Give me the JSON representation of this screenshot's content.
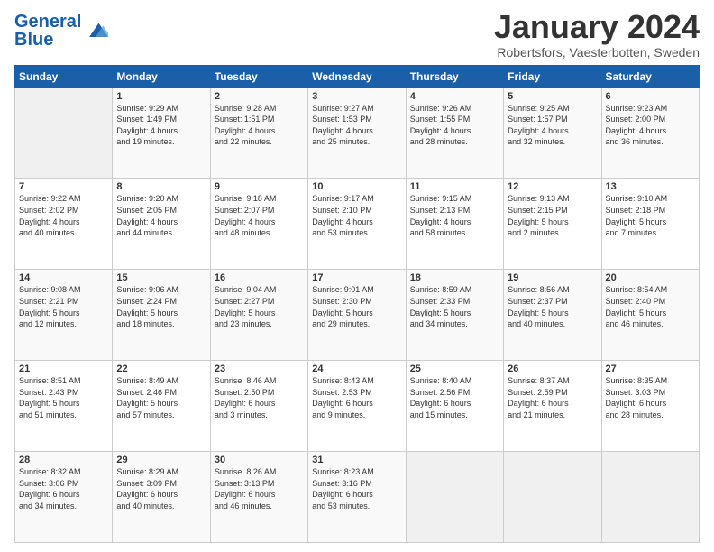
{
  "logo": {
    "general": "General",
    "blue": "Blue"
  },
  "header": {
    "title": "January 2024",
    "subtitle": "Robertsfors, Vaesterbotten, Sweden"
  },
  "days_of_week": [
    "Sunday",
    "Monday",
    "Tuesday",
    "Wednesday",
    "Thursday",
    "Friday",
    "Saturday"
  ],
  "weeks": [
    [
      {
        "day": "",
        "text": ""
      },
      {
        "day": "1",
        "text": "Sunrise: 9:29 AM\nSunset: 1:49 PM\nDaylight: 4 hours\nand 19 minutes."
      },
      {
        "day": "2",
        "text": "Sunrise: 9:28 AM\nSunset: 1:51 PM\nDaylight: 4 hours\nand 22 minutes."
      },
      {
        "day": "3",
        "text": "Sunrise: 9:27 AM\nSunset: 1:53 PM\nDaylight: 4 hours\nand 25 minutes."
      },
      {
        "day": "4",
        "text": "Sunrise: 9:26 AM\nSunset: 1:55 PM\nDaylight: 4 hours\nand 28 minutes."
      },
      {
        "day": "5",
        "text": "Sunrise: 9:25 AM\nSunset: 1:57 PM\nDaylight: 4 hours\nand 32 minutes."
      },
      {
        "day": "6",
        "text": "Sunrise: 9:23 AM\nSunset: 2:00 PM\nDaylight: 4 hours\nand 36 minutes."
      }
    ],
    [
      {
        "day": "7",
        "text": "Sunrise: 9:22 AM\nSunset: 2:02 PM\nDaylight: 4 hours\nand 40 minutes."
      },
      {
        "day": "8",
        "text": "Sunrise: 9:20 AM\nSunset: 2:05 PM\nDaylight: 4 hours\nand 44 minutes."
      },
      {
        "day": "9",
        "text": "Sunrise: 9:18 AM\nSunset: 2:07 PM\nDaylight: 4 hours\nand 48 minutes."
      },
      {
        "day": "10",
        "text": "Sunrise: 9:17 AM\nSunset: 2:10 PM\nDaylight: 4 hours\nand 53 minutes."
      },
      {
        "day": "11",
        "text": "Sunrise: 9:15 AM\nSunset: 2:13 PM\nDaylight: 4 hours\nand 58 minutes."
      },
      {
        "day": "12",
        "text": "Sunrise: 9:13 AM\nSunset: 2:15 PM\nDaylight: 5 hours\nand 2 minutes."
      },
      {
        "day": "13",
        "text": "Sunrise: 9:10 AM\nSunset: 2:18 PM\nDaylight: 5 hours\nand 7 minutes."
      }
    ],
    [
      {
        "day": "14",
        "text": "Sunrise: 9:08 AM\nSunset: 2:21 PM\nDaylight: 5 hours\nand 12 minutes."
      },
      {
        "day": "15",
        "text": "Sunrise: 9:06 AM\nSunset: 2:24 PM\nDaylight: 5 hours\nand 18 minutes."
      },
      {
        "day": "16",
        "text": "Sunrise: 9:04 AM\nSunset: 2:27 PM\nDaylight: 5 hours\nand 23 minutes."
      },
      {
        "day": "17",
        "text": "Sunrise: 9:01 AM\nSunset: 2:30 PM\nDaylight: 5 hours\nand 29 minutes."
      },
      {
        "day": "18",
        "text": "Sunrise: 8:59 AM\nSunset: 2:33 PM\nDaylight: 5 hours\nand 34 minutes."
      },
      {
        "day": "19",
        "text": "Sunrise: 8:56 AM\nSunset: 2:37 PM\nDaylight: 5 hours\nand 40 minutes."
      },
      {
        "day": "20",
        "text": "Sunrise: 8:54 AM\nSunset: 2:40 PM\nDaylight: 5 hours\nand 46 minutes."
      }
    ],
    [
      {
        "day": "21",
        "text": "Sunrise: 8:51 AM\nSunset: 2:43 PM\nDaylight: 5 hours\nand 51 minutes."
      },
      {
        "day": "22",
        "text": "Sunrise: 8:49 AM\nSunset: 2:46 PM\nDaylight: 5 hours\nand 57 minutes."
      },
      {
        "day": "23",
        "text": "Sunrise: 8:46 AM\nSunset: 2:50 PM\nDaylight: 6 hours\nand 3 minutes."
      },
      {
        "day": "24",
        "text": "Sunrise: 8:43 AM\nSunset: 2:53 PM\nDaylight: 6 hours\nand 9 minutes."
      },
      {
        "day": "25",
        "text": "Sunrise: 8:40 AM\nSunset: 2:56 PM\nDaylight: 6 hours\nand 15 minutes."
      },
      {
        "day": "26",
        "text": "Sunrise: 8:37 AM\nSunset: 2:59 PM\nDaylight: 6 hours\nand 21 minutes."
      },
      {
        "day": "27",
        "text": "Sunrise: 8:35 AM\nSunset: 3:03 PM\nDaylight: 6 hours\nand 28 minutes."
      }
    ],
    [
      {
        "day": "28",
        "text": "Sunrise: 8:32 AM\nSunset: 3:06 PM\nDaylight: 6 hours\nand 34 minutes."
      },
      {
        "day": "29",
        "text": "Sunrise: 8:29 AM\nSunset: 3:09 PM\nDaylight: 6 hours\nand 40 minutes."
      },
      {
        "day": "30",
        "text": "Sunrise: 8:26 AM\nSunset: 3:13 PM\nDaylight: 6 hours\nand 46 minutes."
      },
      {
        "day": "31",
        "text": "Sunrise: 8:23 AM\nSunset: 3:16 PM\nDaylight: 6 hours\nand 53 minutes."
      },
      {
        "day": "",
        "text": ""
      },
      {
        "day": "",
        "text": ""
      },
      {
        "day": "",
        "text": ""
      }
    ]
  ]
}
